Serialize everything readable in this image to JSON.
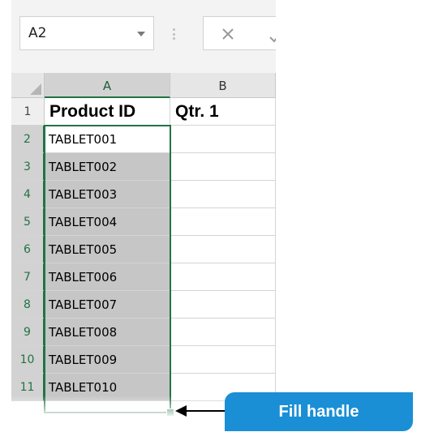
{
  "formula_bar": {
    "name_box_value": "A2",
    "cancel_icon": "close-icon",
    "enter_icon": "check-icon"
  },
  "columns": [
    "A",
    "B"
  ],
  "rows": [
    {
      "num": "1",
      "a": "Product ID",
      "b": "Qtr. 1"
    },
    {
      "num": "2",
      "a": "TABLET001",
      "b": ""
    },
    {
      "num": "3",
      "a": "TABLET002",
      "b": ""
    },
    {
      "num": "4",
      "a": "TABLET003",
      "b": ""
    },
    {
      "num": "5",
      "a": "TABLET004",
      "b": ""
    },
    {
      "num": "6",
      "a": "TABLET005",
      "b": ""
    },
    {
      "num": "7",
      "a": "TABLET006",
      "b": ""
    },
    {
      "num": "8",
      "a": "TABLET007",
      "b": ""
    },
    {
      "num": "9",
      "a": "TABLET008",
      "b": ""
    },
    {
      "num": "10",
      "a": "TABLET009",
      "b": ""
    },
    {
      "num": "11",
      "a": "TABLET010",
      "b": ""
    }
  ],
  "callout": {
    "label": "Fill handle"
  },
  "colors": {
    "selection": "#217346",
    "callout": "#1a8fd5"
  }
}
